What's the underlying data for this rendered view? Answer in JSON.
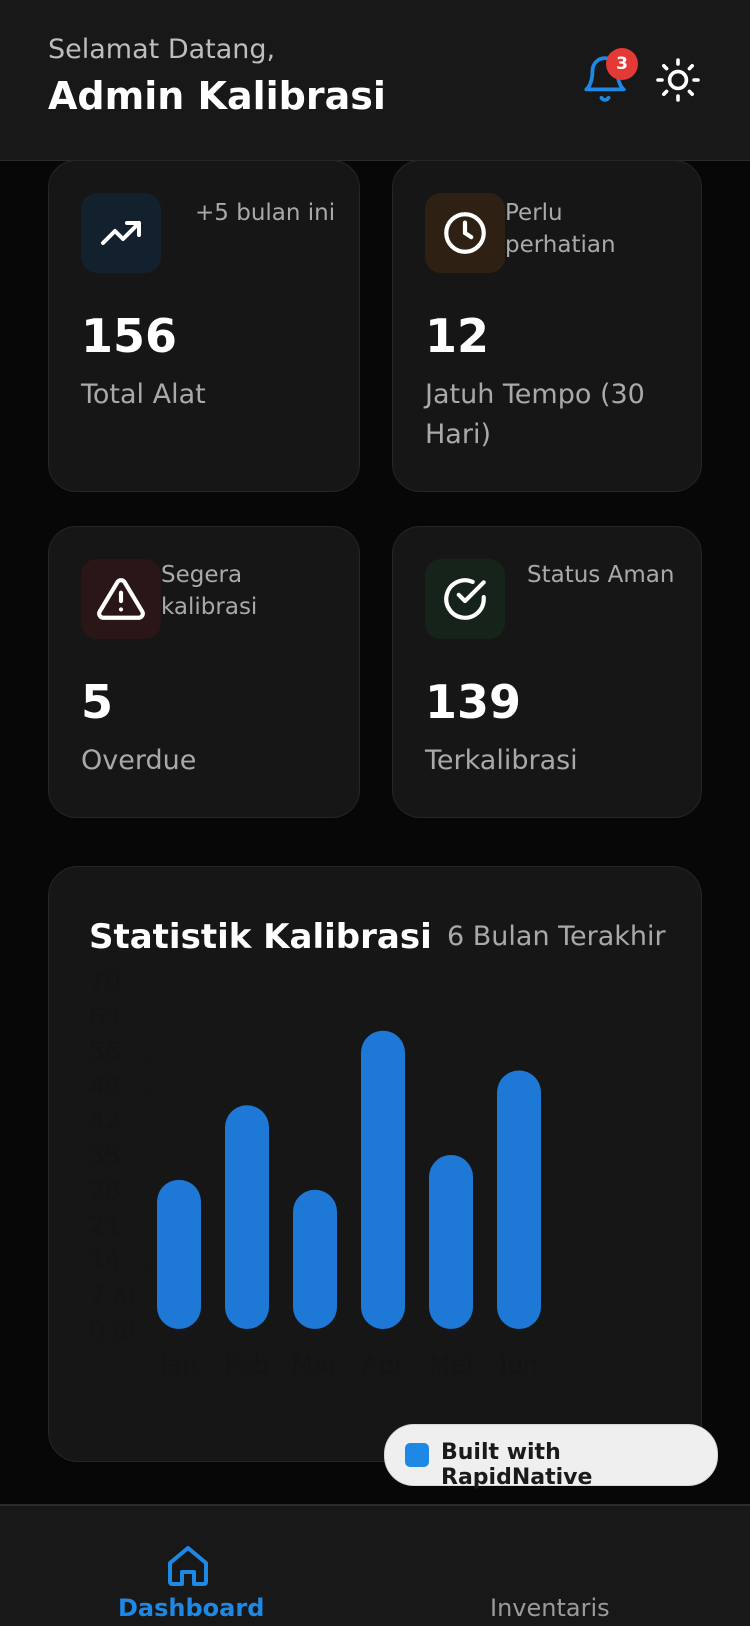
{
  "header": {
    "greeting": "Selamat Datang,",
    "user_name": "Admin Kalibrasi",
    "notification_count": "3"
  },
  "stats": [
    {
      "hint": "+5 bulan ini",
      "value": "156",
      "label": "Total Alat",
      "icon": "trending-up-icon",
      "icon_bg": "#13202d"
    },
    {
      "hint": "Perlu perhatian",
      "value": "12",
      "label": "Jatuh Tempo (30 Hari)",
      "icon": "clock-icon",
      "icon_bg": "#2e2114"
    },
    {
      "hint": "Segera kalibrasi",
      "value": "5",
      "label": "Overdue",
      "icon": "warning-icon",
      "icon_bg": "#2a1616"
    },
    {
      "hint": "Status Aman",
      "value": "139",
      "label": "Terkalibrasi",
      "icon": "check-circle-icon",
      "icon_bg": "#16231a"
    }
  ],
  "chart": {
    "title": "Statistik Kalibrasi",
    "period": "6 Bulan Terakhir"
  },
  "chart_data": {
    "type": "bar",
    "categories": [
      "Jan",
      "Feb",
      "Mar",
      "Apr",
      "Mei",
      "Jun"
    ],
    "values": [
      30,
      45,
      28,
      60,
      35,
      52
    ],
    "ylim": [
      0,
      70
    ],
    "ytick_labels": [
      "0 al...",
      "7 al...",
      "14 ...",
      "21 ...",
      "28 ...",
      "35 ...",
      "42 ...",
      "49 ...",
      "56 ...",
      "63 ...",
      "70 ..."
    ],
    "bar_color": "#1e78d6",
    "grid": false
  },
  "badge": {
    "label": "Built with RapidNative"
  },
  "nav": {
    "items": [
      {
        "label": "Dashboard"
      },
      {
        "label": "Inventaris"
      }
    ]
  }
}
